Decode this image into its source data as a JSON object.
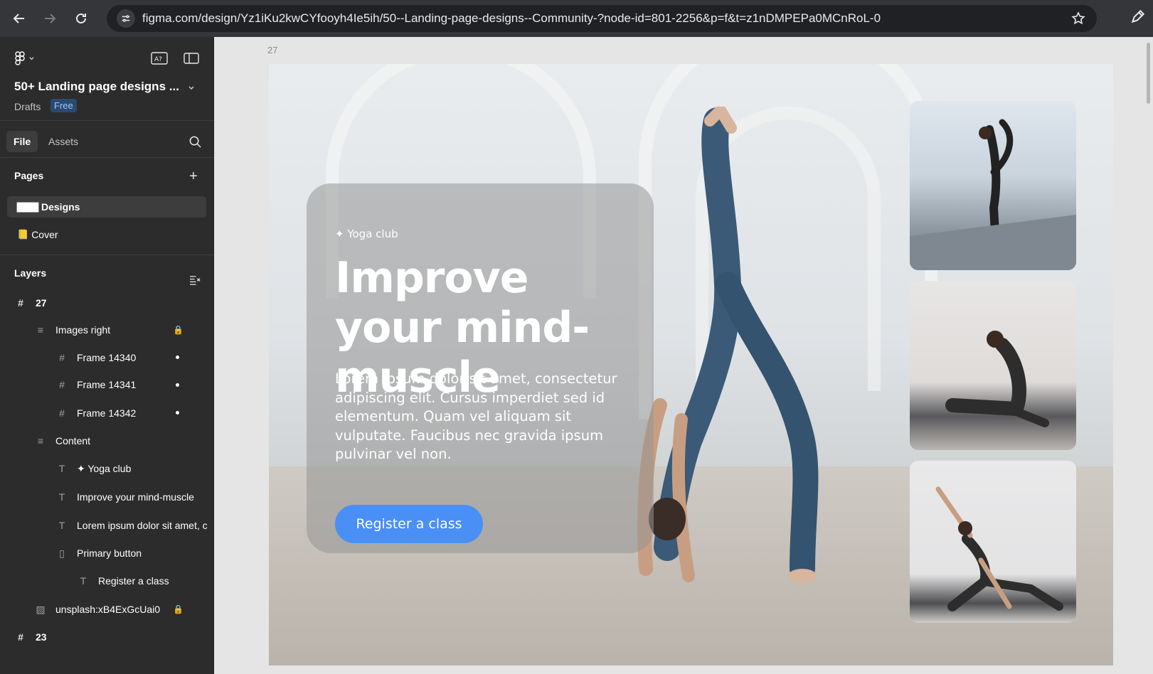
{
  "browser": {
    "url": "figma.com/design/Yz1iKu2kwCYfooyh4Ie5ih/50--Landing-page-designs--Community-?node-id=801-2256&p=f&t=z1nDMPEPa0MCnRoL-0"
  },
  "sidebar": {
    "file_title": "50+ Landing page designs ...",
    "drafts_label": "Drafts",
    "plan_badge": "Free",
    "tabs": {
      "file": "File",
      "assets": "Assets"
    },
    "pages_heading": "Pages",
    "pages": [
      {
        "emoji": "▇▇▇",
        "label": "Designs"
      },
      {
        "emoji": "📒",
        "label": "Cover"
      }
    ],
    "layers_heading": "Layers",
    "layers": [
      {
        "icon": "#",
        "label": "27"
      },
      {
        "icon": "≡",
        "label": "Images right"
      },
      {
        "icon": "#",
        "label": "Frame 14340"
      },
      {
        "icon": "#",
        "label": "Frame 14341"
      },
      {
        "icon": "#",
        "label": "Frame 14342"
      },
      {
        "icon": "≡",
        "label": "Content"
      },
      {
        "icon": "T",
        "label": "✦ Yoga club"
      },
      {
        "icon": "T",
        "label": "Improve your mind-muscle"
      },
      {
        "icon": "T",
        "label": "Lorem ipsum dolor sit amet, c"
      },
      {
        "icon": "▯",
        "label": "Primary button"
      },
      {
        "icon": "T",
        "label": "Register a class"
      },
      {
        "icon": "▨",
        "label": "unsplash:xB4ExGcUai0"
      },
      {
        "icon": "#",
        "label": "23"
      }
    ]
  },
  "canvas": {
    "frame_label": "27",
    "tagline": "✦ Yoga club",
    "headline": "Improve your mind-muscle",
    "body": "Lorem ipsum dolor sit amet, consectetur adipiscing elit. Cursus imperdiet sed id elementum. Quam vel aliquam sit vulputate. Faucibus nec gravida ipsum pulvinar vel non.",
    "cta": "Register a class"
  },
  "colors": {
    "sidebar_bg": "#2c2c2c",
    "browser_bg": "#35363a",
    "cta_blue": "#4a8ff5",
    "canvas_bg": "#e5e5e5"
  }
}
